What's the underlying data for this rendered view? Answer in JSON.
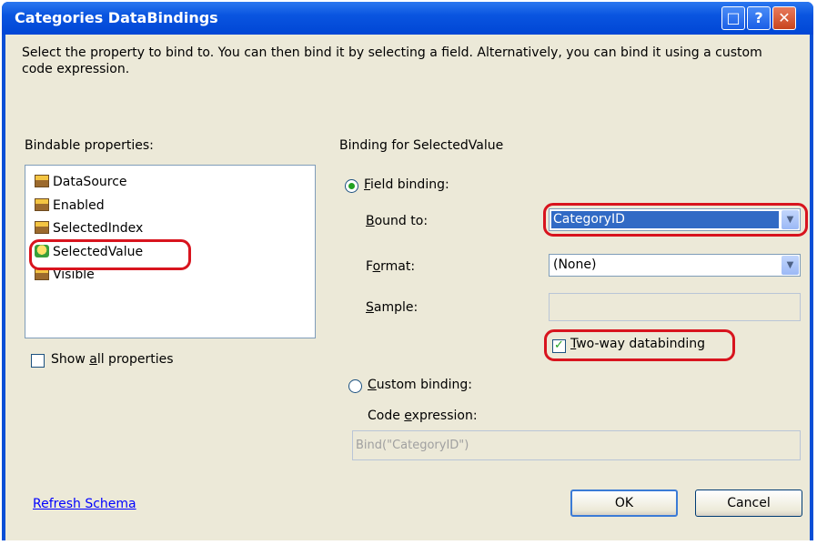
{
  "window": {
    "title": "Categories DataBindings",
    "controls": {
      "maximize": "□",
      "help": "?",
      "close": "✕"
    }
  },
  "description": "Select the property to bind to. You can then bind it by selecting a field. Alternatively, you can bind it using a custom code expression.",
  "bindable_properties": {
    "label": "Bindable properties:",
    "items": [
      {
        "label": "DataSource",
        "icon": "property-icon",
        "selected": false
      },
      {
        "label": "Enabled",
        "icon": "property-icon",
        "selected": false
      },
      {
        "label": "SelectedIndex",
        "icon": "property-icon",
        "selected": false
      },
      {
        "label": "SelectedValue",
        "icon": "default-property-icon",
        "selected": true
      },
      {
        "label": "Visible",
        "icon": "property-icon",
        "selected": false
      }
    ],
    "show_all_label": "Show all properties",
    "show_all_checked": false
  },
  "binding": {
    "heading": "Binding for SelectedValue",
    "field_binding_label": "Field binding:",
    "field_binding_selected": true,
    "bound_to_label": "Bound to:",
    "bound_to_value": "CategoryID",
    "format_label": "Format:",
    "format_value": "(None)",
    "sample_label": "Sample:",
    "sample_value": "",
    "two_way_label": "Two-way databinding",
    "two_way_checked": true,
    "custom_binding_label": "Custom binding:",
    "custom_binding_selected": false,
    "code_expression_label": "Code expression:",
    "code_expression_value": "Bind(\"CategoryID\")"
  },
  "footer": {
    "refresh_link": "Refresh Schema",
    "ok_label": "OK",
    "cancel_label": "Cancel"
  },
  "colors": {
    "title_bar": "#0a55e0",
    "dialog_background": "#ece9d8",
    "highlight_outline": "#d8141e",
    "selection": "#316ac5",
    "link": "#0000ff"
  }
}
